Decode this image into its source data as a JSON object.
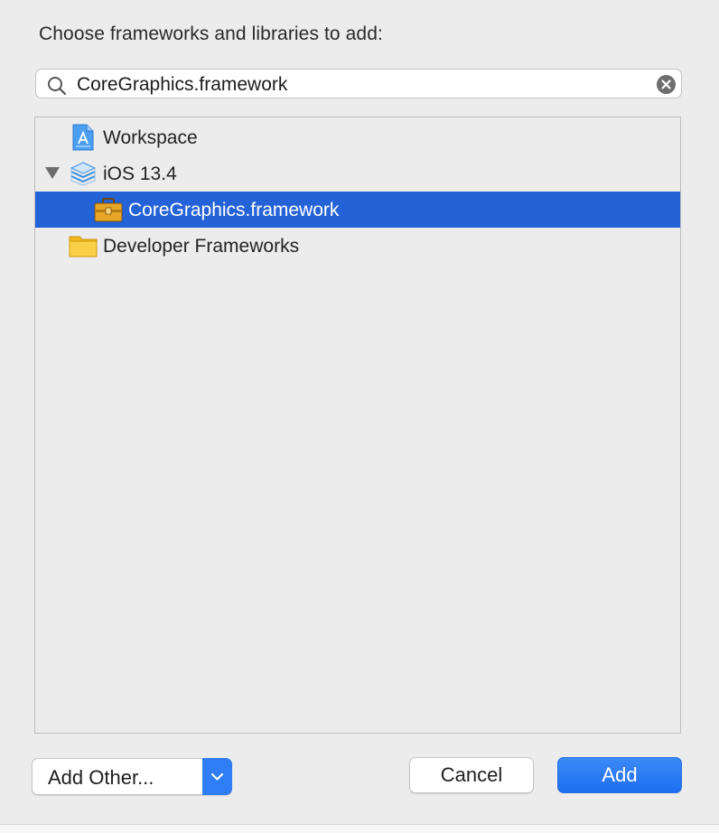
{
  "dialog": {
    "title": "Choose frameworks and libraries to add:"
  },
  "search": {
    "value": "CoreGraphics.framework",
    "icon": "magnifying-glass",
    "clear_icon": "clear-circle-x"
  },
  "tree": {
    "items": [
      {
        "label": "Workspace",
        "icon": "workspace-blueprint-icon",
        "expanded": null,
        "selected": false
      },
      {
        "label": "iOS 13.4",
        "icon": "sdk-stack-icon",
        "expanded": true,
        "selected": false
      },
      {
        "label": "CoreGraphics.framework",
        "icon": "toolbox-framework-icon",
        "expanded": null,
        "selected": true
      },
      {
        "label": "Developer Frameworks",
        "icon": "yellow-folder-icon",
        "expanded": null,
        "selected": false
      }
    ]
  },
  "buttons": {
    "add_other": "Add Other...",
    "cancel": "Cancel",
    "add": "Add"
  },
  "colors": {
    "selection": "#2462d8",
    "accent": "#2f7ef5",
    "background": "#ececec"
  }
}
